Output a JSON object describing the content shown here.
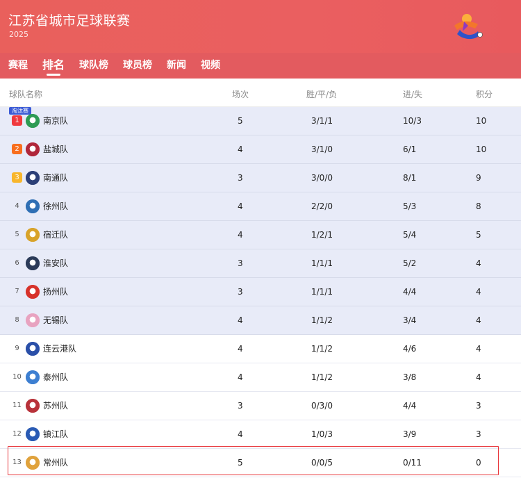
{
  "header": {
    "title": "江苏省城市足球联赛",
    "year": "2025",
    "tabs": [
      "赛程",
      "排名",
      "球队榜",
      "球员榜",
      "新闻",
      "视频"
    ],
    "active_tab": "排名"
  },
  "table": {
    "columns": {
      "team": "球队名称",
      "games": "场次",
      "wdl": "胜/平/负",
      "goals": "进/失",
      "points": "积分"
    },
    "zone_badge": "淘汰赛",
    "rows": [
      {
        "rank": "1",
        "team": "南京队",
        "games": "5",
        "wdl": "3/1/1",
        "goals": "10/3",
        "points": "10",
        "crest_color": "#2e9b54"
      },
      {
        "rank": "2",
        "team": "盐城队",
        "games": "4",
        "wdl": "3/1/0",
        "goals": "6/1",
        "points": "10",
        "crest_color": "#b0263a"
      },
      {
        "rank": "3",
        "team": "南通队",
        "games": "3",
        "wdl": "3/0/0",
        "goals": "8/1",
        "points": "9",
        "crest_color": "#2c3f77"
      },
      {
        "rank": "4",
        "team": "徐州队",
        "games": "4",
        "wdl": "2/2/0",
        "goals": "5/3",
        "points": "8",
        "crest_color": "#2f6fb4"
      },
      {
        "rank": "5",
        "team": "宿迁队",
        "games": "4",
        "wdl": "1/2/1",
        "goals": "5/4",
        "points": "5",
        "crest_color": "#d8a32a"
      },
      {
        "rank": "6",
        "team": "淮安队",
        "games": "3",
        "wdl": "1/1/1",
        "goals": "5/2",
        "points": "4",
        "crest_color": "#2b3a58"
      },
      {
        "rank": "7",
        "team": "扬州队",
        "games": "3",
        "wdl": "1/1/1",
        "goals": "4/4",
        "points": "4",
        "crest_color": "#d7322b"
      },
      {
        "rank": "8",
        "team": "无锡队",
        "games": "4",
        "wdl": "1/1/2",
        "goals": "3/4",
        "points": "4",
        "crest_color": "#e8a3c0"
      },
      {
        "rank": "9",
        "team": "连云港队",
        "games": "4",
        "wdl": "1/1/2",
        "goals": "4/6",
        "points": "4",
        "crest_color": "#2a4fa8"
      },
      {
        "rank": "10",
        "team": "泰州队",
        "games": "4",
        "wdl": "1/1/2",
        "goals": "3/8",
        "points": "4",
        "crest_color": "#3d7fd1"
      },
      {
        "rank": "11",
        "team": "苏州队",
        "games": "3",
        "wdl": "0/3/0",
        "goals": "4/4",
        "points": "3",
        "crest_color": "#b8323a"
      },
      {
        "rank": "12",
        "team": "镇江队",
        "games": "4",
        "wdl": "1/0/3",
        "goals": "3/9",
        "points": "3",
        "crest_color": "#2a5bb4"
      },
      {
        "rank": "13",
        "team": "常州队",
        "games": "5",
        "wdl": "0/0/5",
        "goals": "0/11",
        "points": "0",
        "crest_color": "#e0a23c"
      }
    ]
  },
  "colors": {
    "header": "#e9605c",
    "zone": "#e8ebf8",
    "rank1": "#f0393e",
    "rank2": "#f86e1e",
    "rank3": "#f8b62c",
    "highlight": "#e8353a"
  },
  "icons": [
    "league-logo-icon",
    "team-crest-icon"
  ]
}
